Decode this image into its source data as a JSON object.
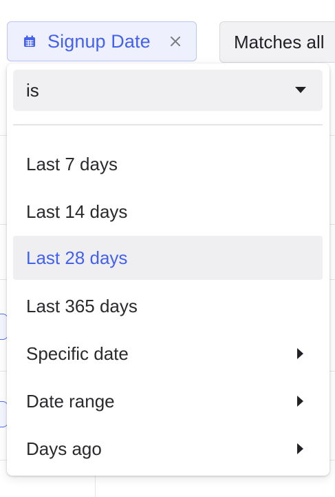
{
  "filter_chip": {
    "label": "Signup Date",
    "icon": "calendar-icon",
    "close_icon": "close-icon",
    "accent_color": "#4361ee"
  },
  "match_button": {
    "label": "Matches all"
  },
  "operator_select": {
    "value": "is",
    "icon": "caret-down-icon"
  },
  "options": [
    {
      "label": "Last 7 days",
      "selected": false,
      "has_submenu": false
    },
    {
      "label": "Last 14 days",
      "selected": false,
      "has_submenu": false
    },
    {
      "label": "Last 28 days",
      "selected": true,
      "has_submenu": false
    },
    {
      "label": "Last 365 days",
      "selected": false,
      "has_submenu": false
    },
    {
      "label": "Specific date",
      "selected": false,
      "has_submenu": true
    },
    {
      "label": "Date range",
      "selected": false,
      "has_submenu": true
    },
    {
      "label": "Days ago",
      "selected": false,
      "has_submenu": true
    }
  ]
}
